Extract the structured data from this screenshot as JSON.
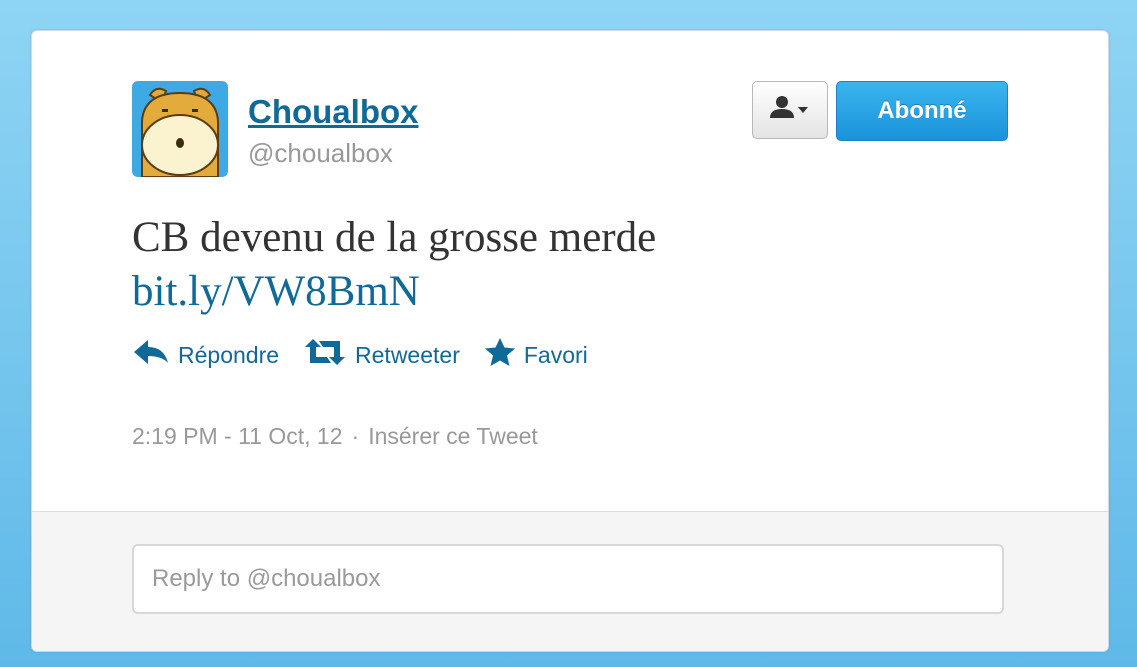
{
  "user": {
    "display_name": "Choualbox",
    "handle": "@choualbox"
  },
  "header": {
    "follow_label": "Abonné",
    "user_menu_icon": "person-dropdown-icon"
  },
  "tweet": {
    "text": "CB devenu de la grosse merde ",
    "link_text": "bit.ly/VW8BmN"
  },
  "actions": {
    "reply_label": "Répondre",
    "retweet_label": "Retweeter",
    "favorite_label": "Favori"
  },
  "meta": {
    "timestamp": "2:19 PM - 11 Oct, 12",
    "separator": "·",
    "embed_label": "Insérer ce Tweet"
  },
  "reply_box": {
    "placeholder": "Reply to @choualbox"
  },
  "colors": {
    "link": "#0f6a99",
    "follow_button": "#1a93da",
    "background": "#5fb9e8"
  }
}
